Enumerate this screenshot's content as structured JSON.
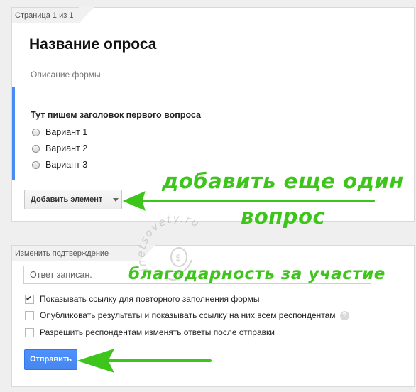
{
  "page": {
    "label": "Страница 1 из 1",
    "form_title": "Название опроса",
    "form_description": "Описание формы"
  },
  "question": {
    "title": "Тут пишем заголовок первого вопроса",
    "options": [
      "Вариант 1",
      "Вариант 2",
      "Вариант 3"
    ]
  },
  "add_element": {
    "label": "Добавить элемент"
  },
  "confirmation": {
    "label": "Изменить подтверждение",
    "input_value": "Ответ записан.",
    "checkboxes": [
      {
        "label": "Показывать ссылку для повторного заполнения формы",
        "checked": true
      },
      {
        "label": "Опубликовать результаты и показывать ссылку на них всем респондентам",
        "checked": false
      },
      {
        "label": "Разрешить респондентам изменять ответы после отправки",
        "checked": false
      }
    ],
    "help_icon": "?",
    "submit_label": "Отправить"
  },
  "annotations": {
    "line1": "добавить еще один",
    "line2": "вопрос",
    "line3": "благодарность за участие",
    "color": "#3ec51b"
  },
  "watermark": {
    "text": "inetsovety.ru"
  },
  "colors": {
    "accent_blue": "#4a8af4",
    "button_blue": "#4d90fe"
  }
}
